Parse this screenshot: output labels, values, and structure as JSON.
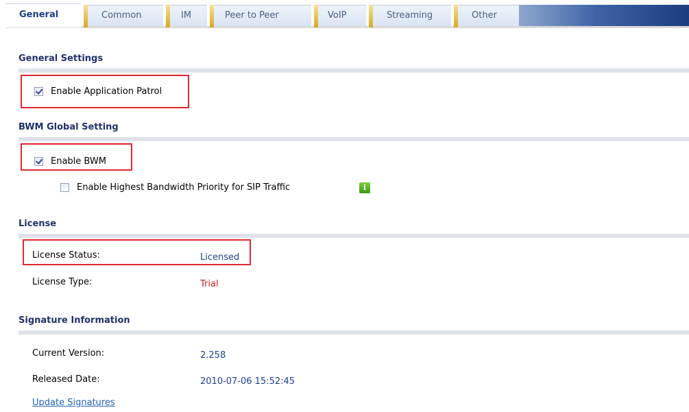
{
  "tabs": [
    {
      "label": "General",
      "active": true
    },
    {
      "label": "Common",
      "active": false
    },
    {
      "label": "IM",
      "active": false
    },
    {
      "label": "Peer to Peer",
      "active": false
    },
    {
      "label": "VoIP",
      "active": false
    },
    {
      "label": "Streaming",
      "active": false
    },
    {
      "label": "Other",
      "active": false
    }
  ],
  "general_settings": {
    "title": "General Settings",
    "enable_app_patrol": {
      "label": "Enable Application Patrol",
      "checked": true
    }
  },
  "bwm": {
    "title": "BWM Global Setting",
    "enable_bwm": {
      "label": "Enable BWM",
      "checked": true
    },
    "sip_priority": {
      "label": "Enable Highest Bandwidth Priority for SIP Traffic",
      "checked": false
    },
    "info_icon": "i"
  },
  "license": {
    "title": "License",
    "status_label": "License Status:",
    "status_value": "Licensed",
    "type_label": "License Type:",
    "type_value": "Trial"
  },
  "signature": {
    "title": "Signature Information",
    "version_label": "Current Version:",
    "version_value": "2.258",
    "date_label": "Released Date:",
    "date_value": "2010-07-06 15:52:45",
    "update_link": "Update Signatures"
  },
  "colors": {
    "highlight": "#e2262c",
    "section_title": "#21306b",
    "licensed": "#1d3f95",
    "trial": "#d21a1a",
    "link": "#2161b8",
    "info_icon": "#4fae22"
  }
}
